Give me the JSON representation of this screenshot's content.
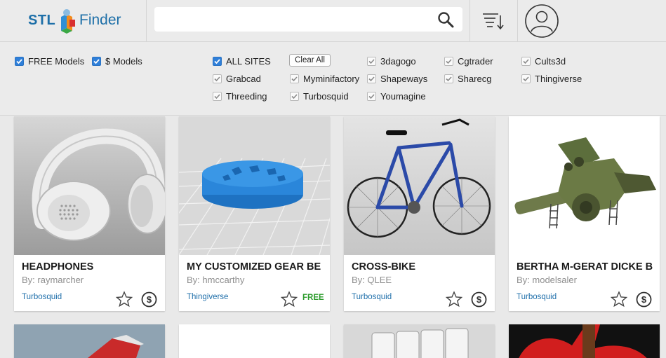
{
  "header": {
    "logo_stl": "STL",
    "logo_finder": "Finder",
    "search_placeholder": ""
  },
  "filters": {
    "free_models": {
      "label": "FREE Models",
      "checked": true
    },
    "paid_models": {
      "label": "$ Models",
      "checked": true
    },
    "all_sites": {
      "label": "ALL SITES",
      "checked": true
    },
    "clear_all": "Clear All",
    "sites": [
      {
        "label": "3dagogo",
        "checked": true
      },
      {
        "label": "Cgtrader",
        "checked": true
      },
      {
        "label": "Cults3d",
        "checked": true
      },
      {
        "label": "Grabcad",
        "checked": true
      },
      {
        "label": "Myminifactory",
        "checked": true
      },
      {
        "label": "Shapeways",
        "checked": true
      },
      {
        "label": "Sharecg",
        "checked": true
      },
      {
        "label": "Thingiverse",
        "checked": true
      },
      {
        "label": "Threeding",
        "checked": true
      },
      {
        "label": "Turbosquid",
        "checked": true
      },
      {
        "label": "Youmagine",
        "checked": true
      }
    ]
  },
  "cards": [
    {
      "title": "HEADPHONES",
      "author": "By: raymarcher",
      "site": "Turbosquid",
      "price": "paid-icon"
    },
    {
      "title": "MY CUSTOMIZED GEAR BE",
      "author": "By: hmccarthy",
      "site": "Thingiverse",
      "price_text": "FREE"
    },
    {
      "title": "CROSS-BIKE",
      "author": "By: QLEE",
      "site": "Turbosquid",
      "price": "paid-icon"
    },
    {
      "title": "BERTHA M-GERAT DICKE B",
      "author": "By: modelsaler",
      "site": "Turbosquid",
      "price": "paid-icon"
    }
  ],
  "colors": {
    "accent": "#2f7fd9",
    "link": "#1f6faa",
    "free": "#2e9c2e",
    "background": "#ebebeb"
  }
}
